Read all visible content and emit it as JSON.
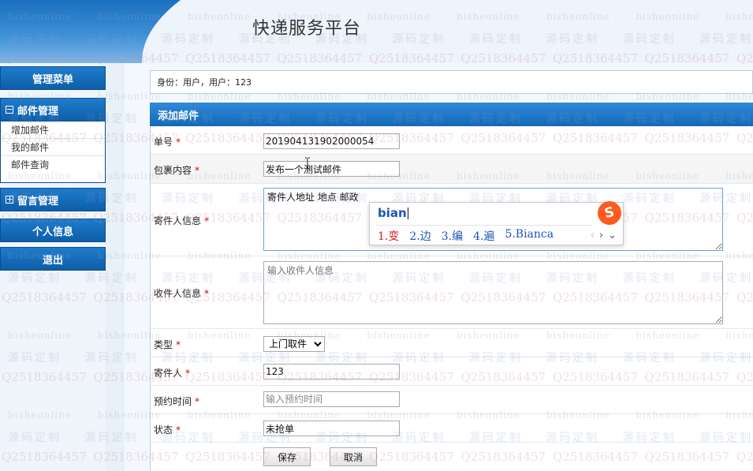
{
  "header": {
    "title": "快递服务平台"
  },
  "sidebar": {
    "menu_title": "管理菜单",
    "mail_group": {
      "label": "邮件管理",
      "items": [
        "增加邮件",
        "我的邮件",
        "邮件查询"
      ]
    },
    "message_group": {
      "label": "留言管理"
    },
    "personal_info": "个人信息",
    "logout": "退出"
  },
  "identity": {
    "text": "身份：用户，用户：123"
  },
  "form": {
    "title": "添加邮件",
    "fields": {
      "order_no": {
        "label": "单号",
        "value": "201904131902000054"
      },
      "package_content": {
        "label": "包裹内容",
        "value": "发布一个测试邮件"
      },
      "sender_info": {
        "label": "寄件人信息",
        "value": "寄件人地址 地点 邮政"
      },
      "receiver_info": {
        "label": "收件人信息",
        "placeholder": "输入收件人信息"
      },
      "type": {
        "label": "类型",
        "value": "上门取件"
      },
      "sender": {
        "label": "寄件人",
        "value": "123"
      },
      "appointment_time": {
        "label": "预约时间",
        "placeholder": "输入预约时间"
      },
      "status": {
        "label": "状态",
        "value": "未抢单"
      }
    },
    "required_mark": "*",
    "save_label": "保存",
    "cancel_label": "取消"
  },
  "ime": {
    "composition": "bian",
    "candidates": [
      "1.变",
      "2.边",
      "3.编",
      "4.遍",
      "5.Bianca"
    ],
    "prev": "‹",
    "next": "›",
    "more": "⌄",
    "logo_text": "S"
  },
  "watermark": {
    "line_a": "bisheonline",
    "line_b": "源码定制",
    "line_c": "Q2518364457"
  },
  "colors": {
    "accent": "#1468b6",
    "required": "#dd0000",
    "ime_selected": "#d21e1e",
    "ime_candidate": "#1a56b8"
  }
}
